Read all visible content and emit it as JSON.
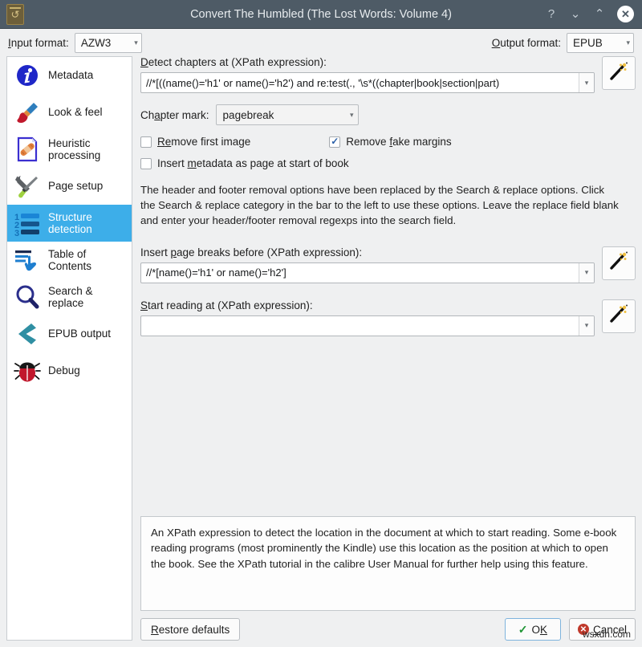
{
  "window": {
    "title": "Convert The Humbled (The Lost Words: Volume 4)",
    "app_icon": "convert-book-icon",
    "buttons": {
      "help": "?",
      "minimize": "⌄",
      "maximize": "⌃",
      "close": "✕"
    }
  },
  "format_bar": {
    "input_label_prefix": "I",
    "input_label": "nput format:",
    "input_value": "AZW3",
    "output_label_prefix": "O",
    "output_label": "utput format:",
    "output_value": "EPUB",
    "arrow": "▾"
  },
  "sidebar": {
    "items": [
      {
        "label": "Metadata",
        "icon": "info-circle-icon",
        "selected": false
      },
      {
        "label": "Look & feel",
        "icon": "paintbrush-icon",
        "selected": false
      },
      {
        "label": "Heuristic processing",
        "icon": "page-bandage-icon",
        "selected": false
      },
      {
        "label": "Page setup",
        "icon": "wrench-screwdriver-icon",
        "selected": false
      },
      {
        "label": "Structure detection",
        "icon": "numbered-list-icon",
        "selected": true
      },
      {
        "label": "Table of Contents",
        "icon": "toc-hand-icon",
        "selected": false
      },
      {
        "label": "Search & replace",
        "icon": "magnifier-icon",
        "selected": false
      },
      {
        "label": "EPUB output",
        "icon": "left-chevron-icon",
        "selected": false
      },
      {
        "label": "Debug",
        "icon": "ladybug-icon",
        "selected": false
      }
    ]
  },
  "main": {
    "detect_chapters": {
      "label_prefix": "D",
      "label": "etect chapters at (XPath expression):",
      "value": "//*[((name()='h1' or name()='h2') and re:test(., '\\s*((chapter|book|section|part)",
      "wand": "magic-wand-icon",
      "arrow": "▾"
    },
    "chapter_mark": {
      "label_prefix": "Ch",
      "label_mid": "a",
      "label_rest": "pter mark:",
      "value": "pagebreak",
      "arrow": "▾"
    },
    "checkboxes": [
      {
        "label_a": "R",
        "label_b": "e",
        "label_c": "move first image",
        "checked": false,
        "name": "remove-first-image"
      },
      {
        "label_a": "Remove ",
        "label_b": "f",
        "label_c": "ake margins",
        "checked": true,
        "name": "remove-fake-margins"
      },
      {
        "label_a": "Insert ",
        "label_b": "m",
        "label_c": "etadata as page at start of book",
        "checked": false,
        "name": "insert-metadata-as-page"
      }
    ],
    "notice": "The header and footer removal options have been replaced by the Search & replace options. Click the Search & replace category in the bar to the left to use these options. Leave the replace field blank and enter your header/footer removal regexps into the search field.",
    "page_breaks": {
      "label_a": "Insert ",
      "label_b": "p",
      "label_c": "age breaks before (XPath expression):",
      "value": "//*[name()='h1' or name()='h2']",
      "wand": "magic-wand-icon",
      "arrow": "▾"
    },
    "start_reading": {
      "label_a": "S",
      "label_b": "t",
      "label_c": "art reading at (XPath expression):",
      "value": "",
      "wand": "magic-wand-icon",
      "arrow": "▾"
    },
    "help_text": "An XPath expression to detect the location in the document at which to start reading. Some e-book reading programs (most prominently the Kindle) use this location as the position at which to open the book. See the XPath tutorial in the calibre User Manual for further help using this feature."
  },
  "footer": {
    "restore_prefix": "R",
    "restore_label": "estore defaults",
    "ok_prefix": "O",
    "ok_mid": "K",
    "ok_label": "OK",
    "cancel_prefix": "C",
    "cancel_label": "ancel",
    "watermark": "wsxdn.com"
  },
  "colors": {
    "titlebar": "#4e5b66",
    "selection": "#3daee9",
    "window_bg": "#eff0f1",
    "ok_check": "#1e9434",
    "cancel_red": "#c0392b"
  }
}
